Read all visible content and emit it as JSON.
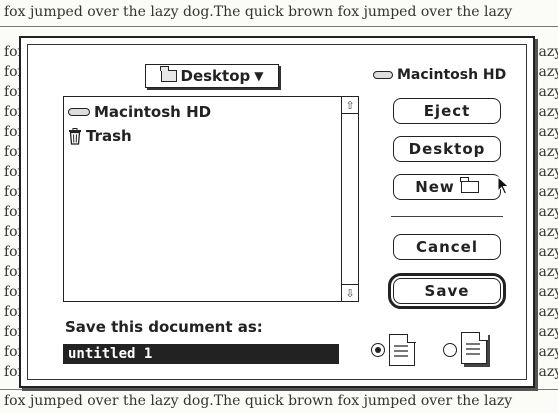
{
  "background_text": {
    "top_line": "fox jumped over the lazy dog.The quick brown fox jumped over the lazy",
    "bottom_line": "fox jumped over the lazy dog.The quick brown fox jumped over the lazy",
    "left_fragment": "fox",
    "right_fragment": "lazy"
  },
  "dialog": {
    "folder_popup": {
      "label": "Desktop",
      "icon": "folder-icon",
      "arrow": "▼"
    },
    "volume": {
      "label": "Macintosh HD",
      "icon": "hard-disk-icon"
    },
    "file_list": {
      "items": [
        {
          "label": "Macintosh HD",
          "icon": "hard-disk-icon"
        },
        {
          "label": "Trash",
          "icon": "trash-icon"
        }
      ],
      "scroll_up": "⇧",
      "scroll_down": "⇩"
    },
    "buttons": {
      "eject": "Eject",
      "desktop": "Desktop",
      "new": "New",
      "cancel": "Cancel",
      "save": "Save"
    },
    "save_prompt": "Save this document as:",
    "filename": "untitled 1",
    "format_options": [
      {
        "selected": true,
        "icon": "document-icon"
      },
      {
        "selected": false,
        "icon": "stationery-icon"
      }
    ]
  },
  "colors": {
    "accent": "#222222",
    "selection": "#222222",
    "paper": "#fbfbf8"
  }
}
